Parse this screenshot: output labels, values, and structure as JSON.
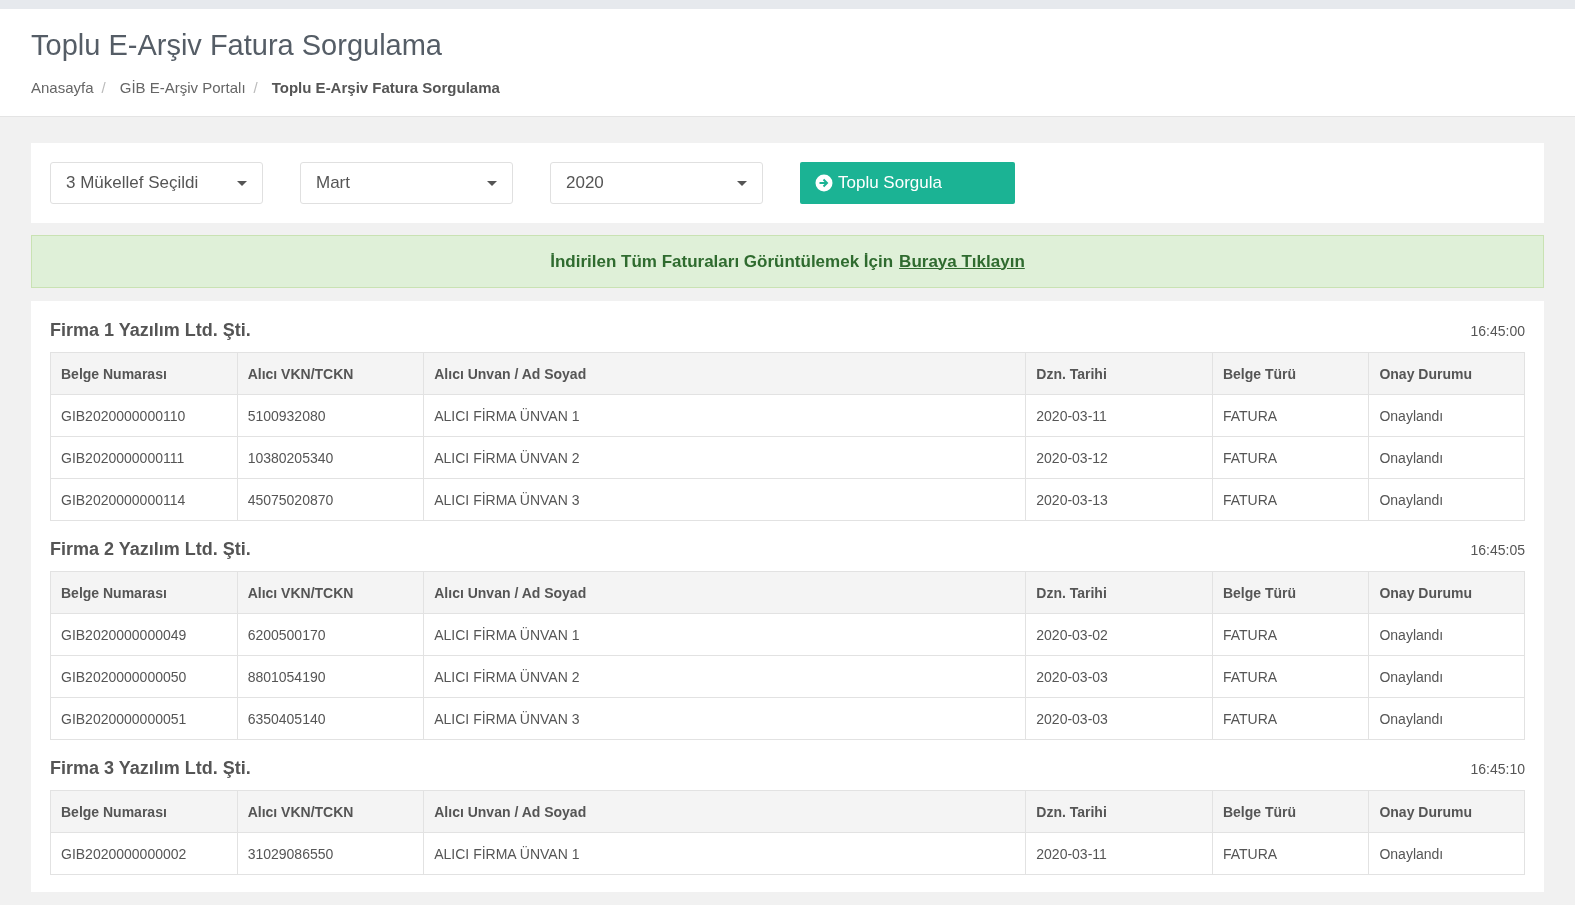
{
  "page_title": "Toplu E-Arşiv Fatura Sorgulama",
  "breadcrumb": {
    "separator": "/",
    "items": [
      {
        "label": "Anasayfa",
        "current": false
      },
      {
        "label": "GİB E-Arşiv Portalı",
        "current": false
      },
      {
        "label": "Toplu E-Arşiv Fatura Sorgulama",
        "current": true
      }
    ]
  },
  "filters": [
    {
      "value": "3 Mükellef Seçildi"
    },
    {
      "value": "Mart"
    },
    {
      "value": "2020"
    }
  ],
  "query_button": {
    "label": "Toplu Sorgula"
  },
  "alert": {
    "text": "İndirilen Tüm Faturaları Görüntülemek İçin",
    "link": "Buraya Tıklayın"
  },
  "results": [
    {
      "company": "Firma 1 Yazılım Ltd. Şti.",
      "time": "16:45:00",
      "columns": [
        "Belge Numarası",
        "Alıcı VKN/TCKN",
        "Alıcı Unvan / Ad Soyad",
        "Dzn. Tarihi",
        "Belge Türü",
        "Onay Durumu"
      ],
      "rows": [
        [
          "GIB2020000000110",
          "5100932080",
          "ALICI FİRMA ÜNVAN 1",
          "2020-03-11",
          "FATURA",
          "Onaylandı"
        ],
        [
          "GIB2020000000111",
          "10380205340",
          "ALICI FİRMA ÜNVAN 2",
          "2020-03-12",
          "FATURA",
          "Onaylandı"
        ],
        [
          "GIB2020000000114",
          "45075020870",
          "ALICI FİRMA ÜNVAN 3",
          "2020-03-13",
          "FATURA",
          "Onaylandı"
        ]
      ]
    },
    {
      "company": "Firma 2 Yazılım Ltd. Şti.",
      "time": "16:45:05",
      "columns": [
        "Belge Numarası",
        "Alıcı VKN/TCKN",
        "Alıcı Unvan / Ad Soyad",
        "Dzn. Tarihi",
        "Belge Türü",
        "Onay Durumu"
      ],
      "rows": [
        [
          "GIB2020000000049",
          "6200500170",
          "ALICI FİRMA ÜNVAN 1",
          "2020-03-02",
          "FATURA",
          "Onaylandı"
        ],
        [
          "GIB2020000000050",
          "8801054190",
          "ALICI FİRMA ÜNVAN 2",
          "2020-03-03",
          "FATURA",
          "Onaylandı"
        ],
        [
          "GIB2020000000051",
          "6350405140",
          "ALICI FİRMA ÜNVAN 3",
          "2020-03-03",
          "FATURA",
          "Onaylandı"
        ]
      ]
    },
    {
      "company": "Firma 3 Yazılım Ltd. Şti.",
      "time": "16:45:10",
      "columns": [
        "Belge Numarası",
        "Alıcı VKN/TCKN",
        "Alıcı Unvan / Ad Soyad",
        "Dzn. Tarihi",
        "Belge Türü",
        "Onay Durumu"
      ],
      "rows": [
        [
          "GIB2020000000002",
          "31029086550",
          "ALICI FİRMA ÜNVAN 1",
          "2020-03-11",
          "FATURA",
          "Onaylandı"
        ]
      ]
    }
  ]
}
